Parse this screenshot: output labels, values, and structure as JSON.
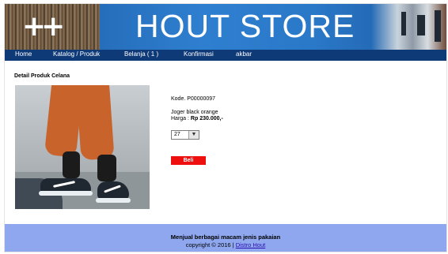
{
  "banner": {
    "logo_icon": "double-cross-logo",
    "title": "HOUT STORE"
  },
  "nav": {
    "items": [
      {
        "label": "Home"
      },
      {
        "label": "Katalog / Produk"
      },
      {
        "label": "Belanja  ( 1 )"
      },
      {
        "label": "Konfirmasi"
      },
      {
        "label": "akbar"
      }
    ]
  },
  "product": {
    "heading": "Detail Produk Celana",
    "code": "Kode. P00000097",
    "name": "Joger black orange",
    "price_label": "Harga :",
    "price_value": "Rp 230.000,-",
    "size_selected": "27",
    "buy_label": "Beli"
  },
  "footer": {
    "tagline": "Menjual berbagai macam jenis pakaian",
    "copyright": "copyright © 2016 |",
    "link_text": "Distro Hout"
  },
  "colors": {
    "nav_bg": "#0f3a78",
    "buy_button": "#ee0f0f",
    "footer_bg": "#8fa7ee"
  }
}
